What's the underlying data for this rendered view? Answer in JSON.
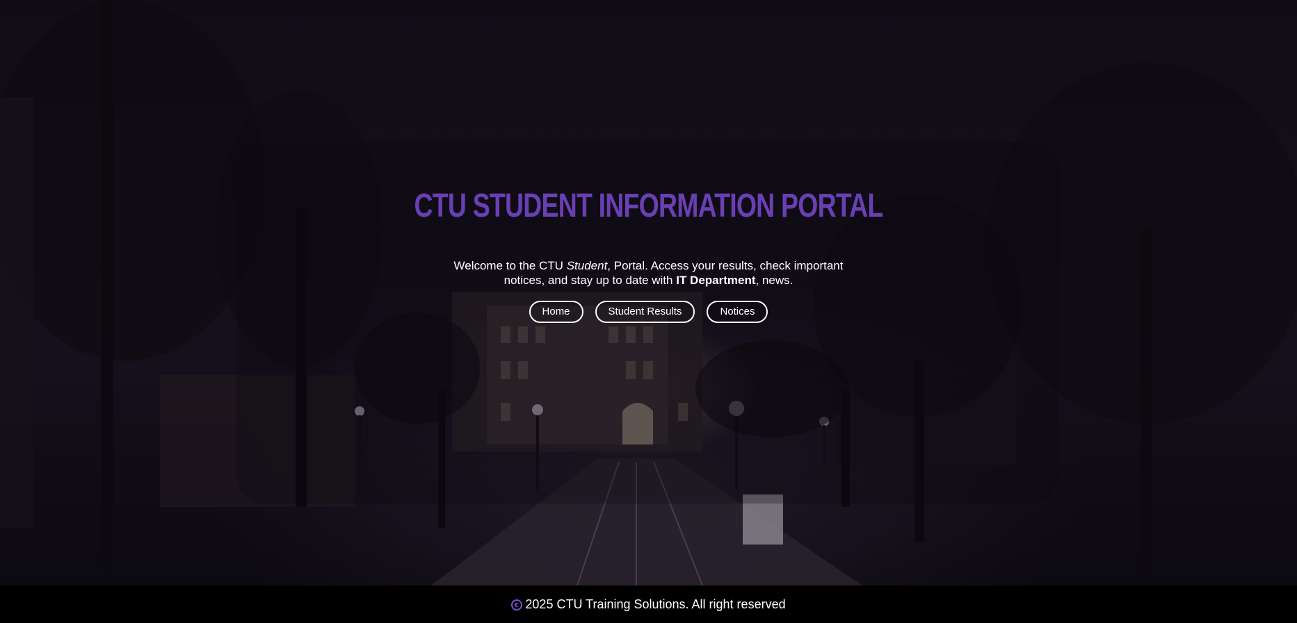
{
  "hero": {
    "title": "CTU STUDENT INFORMATION PORTAL",
    "welcome_part1": "Welcome to the CTU ",
    "welcome_italic": "Student",
    "welcome_part2": ", Portal. Access your results, check important notices, and stay up to date with ",
    "welcome_bold": "IT Department",
    "welcome_part3": ", news."
  },
  "nav": {
    "items": [
      {
        "label": "Home"
      },
      {
        "label": "Student Results"
      },
      {
        "label": "Notices"
      }
    ]
  },
  "footer": {
    "icon": "copyright-icon",
    "text": "2025 CTU Training Solutions. All right reserved"
  },
  "colors": {
    "accent": "#6a3fb4",
    "footer_bg": "#000000",
    "text": "#ffffff"
  }
}
